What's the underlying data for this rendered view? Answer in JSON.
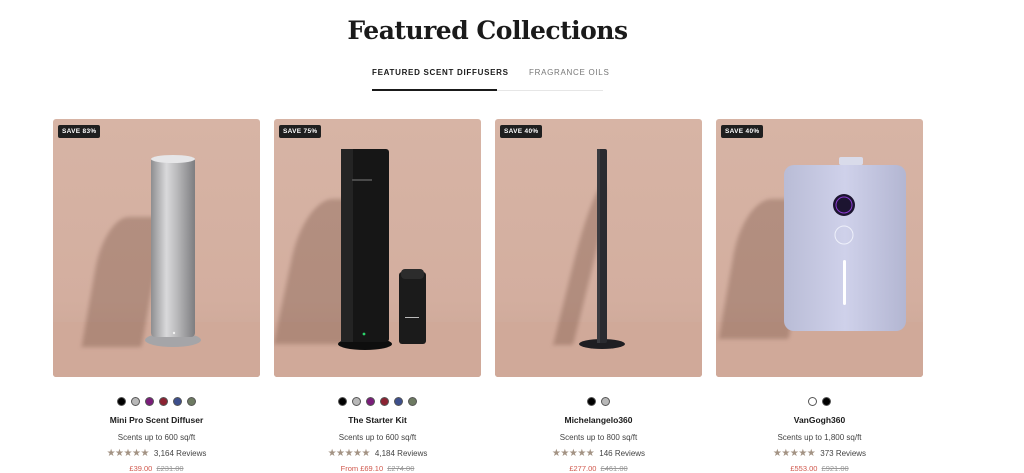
{
  "section": {
    "title": "Featured Collections",
    "tabs": [
      {
        "label": "FEATURED SCENT DIFFUSERS",
        "active": true
      },
      {
        "label": "FRAGRANCE OILS",
        "active": false
      }
    ]
  },
  "products": [
    {
      "badge": "SAVE 83%",
      "name": "Mini Pro Scent Diffuser",
      "coverage": "Scents up to 600 sq/ft",
      "stars": "★★★★★",
      "reviews": "3,164 Reviews",
      "price": "£39.00",
      "was": "£231.00",
      "swatches": [
        "#000000",
        "#b8b8b8",
        "#7a1d7a",
        "#8b2232",
        "#3d4f8c",
        "#6d7a62"
      ]
    },
    {
      "badge": "SAVE 75%",
      "name": "The Starter Kit",
      "coverage": "Scents up to 600 sq/ft",
      "stars": "★★★★★",
      "reviews": "4,184 Reviews",
      "price": "From £69.10",
      "was": "£274.00",
      "swatches": [
        "#000000",
        "#b8b8b8",
        "#7a1d7a",
        "#8b2232",
        "#3d4f8c",
        "#6d7a62"
      ]
    },
    {
      "badge": "SAVE 40%",
      "name": "Michelangelo360",
      "coverage": "Scents up to 800 sq/ft",
      "stars": "★★★★★",
      "reviews": "146 Reviews",
      "price": "£277.00",
      "was": "£461.00",
      "swatches": [
        "#000000",
        "#b8b8b8"
      ]
    },
    {
      "badge": "SAVE 40%",
      "name": "VanGogh360",
      "coverage": "Scents up to 1,800 sq/ft",
      "stars": "★★★★★",
      "reviews": "373 Reviews",
      "price": "£553.00",
      "was": "£921.00",
      "swatches": [
        "#ffffff",
        "#000000"
      ]
    }
  ]
}
